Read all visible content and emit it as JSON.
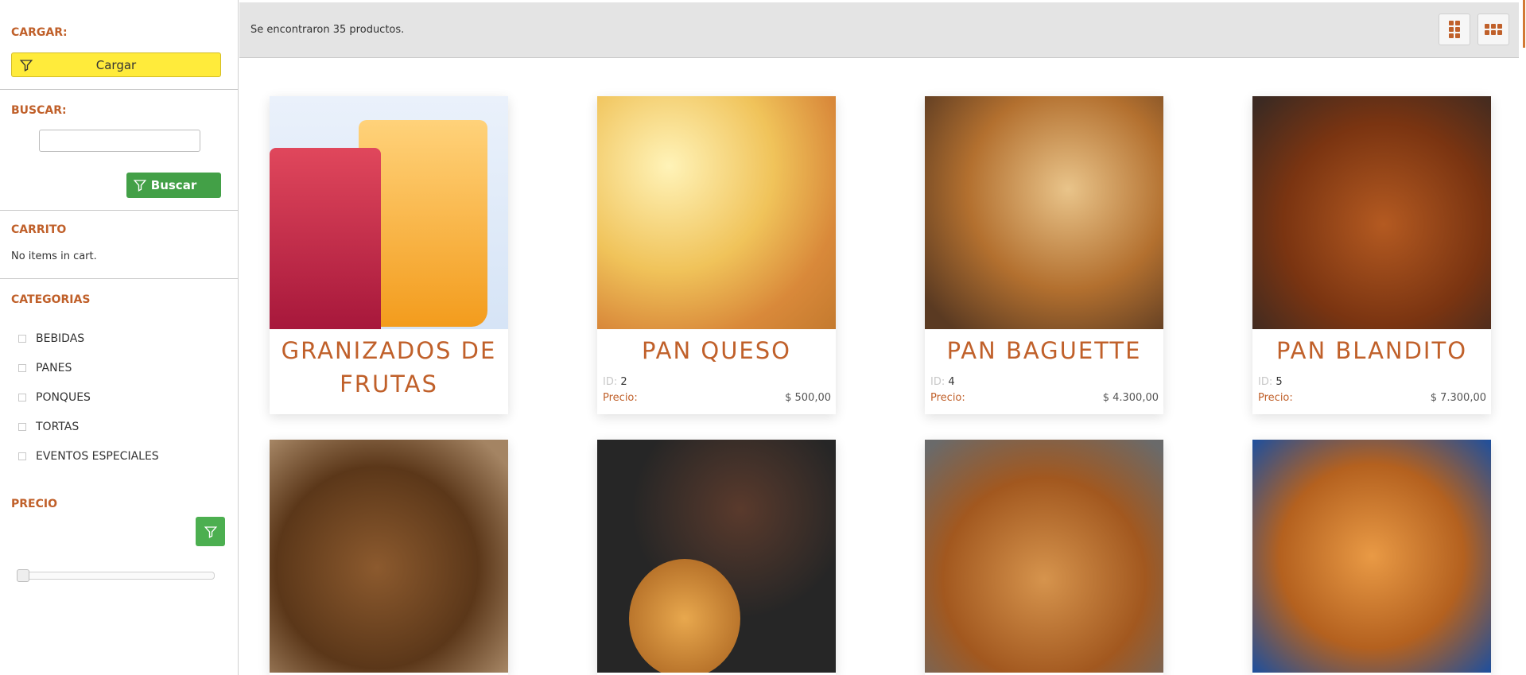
{
  "sidebar": {
    "cargar": {
      "title": "CARGAR:",
      "button_label": "Cargar"
    },
    "buscar": {
      "title": "BUSCAR:",
      "input_value": "",
      "button_label": "Buscar"
    },
    "carrito": {
      "title": "CARRITO",
      "empty_text": "No items in cart."
    },
    "categorias": {
      "title": "CATEGORIAS",
      "items": [
        {
          "label": "BEBIDAS"
        },
        {
          "label": "PANES"
        },
        {
          "label": "PONQUES"
        },
        {
          "label": "TORTAS"
        },
        {
          "label": "EVENTOS ESPECIALES"
        }
      ]
    },
    "precio": {
      "title": "PRECIO",
      "slider_value_fraction": 0
    }
  },
  "topbar": {
    "result_text": "Se encontraron 35 productos."
  },
  "products": [
    {
      "name": "GRANIZADOS DE FRUTAS",
      "image": "fruit-smoothies"
    },
    {
      "name": "PAN QUESO",
      "id_label": "ID:",
      "id": "2",
      "price_label": "Precio:",
      "price": "$ 500,00",
      "image": "cheese-bread"
    },
    {
      "name": "PAN BAGUETTE",
      "id_label": "ID:",
      "id": "4",
      "price_label": "Precio:",
      "price": "$ 4.300,00",
      "image": "baguette"
    },
    {
      "name": "PAN BLANDITO",
      "id_label": "ID:",
      "id": "5",
      "price_label": "Precio:",
      "price": "$ 7.300,00",
      "image": "sweet-bread"
    },
    {
      "image": "whole-grain-bread"
    },
    {
      "image": "palmeras-chocolate"
    },
    {
      "image": "baguettes"
    },
    {
      "image": "bread-rolls"
    }
  ],
  "colors": {
    "accent": "#c0602a",
    "cargar_button": "#ffeb3b",
    "buscar_button": "#43a047",
    "topbar": "#e4e4e4"
  }
}
